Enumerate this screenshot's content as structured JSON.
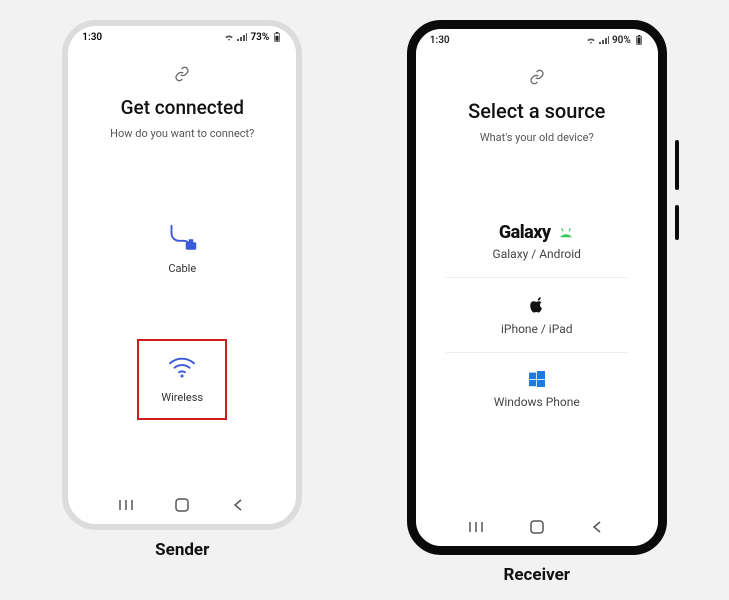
{
  "sender": {
    "caption": "Sender",
    "status": {
      "time": "1:30",
      "battery": "73%"
    },
    "title": "Get connected",
    "subtitle": "How do you want to connect?",
    "options": {
      "cable": "Cable",
      "wireless": "Wireless"
    }
  },
  "receiver": {
    "caption": "Receiver",
    "status": {
      "time": "1:30",
      "battery": "90%"
    },
    "title": "Select a source",
    "subtitle": "What's your old device?",
    "sources": {
      "galaxy_brand": "Galaxy",
      "galaxy": "Galaxy / Android",
      "iphone": "iPhone / iPad",
      "windows": "Windows Phone"
    }
  }
}
